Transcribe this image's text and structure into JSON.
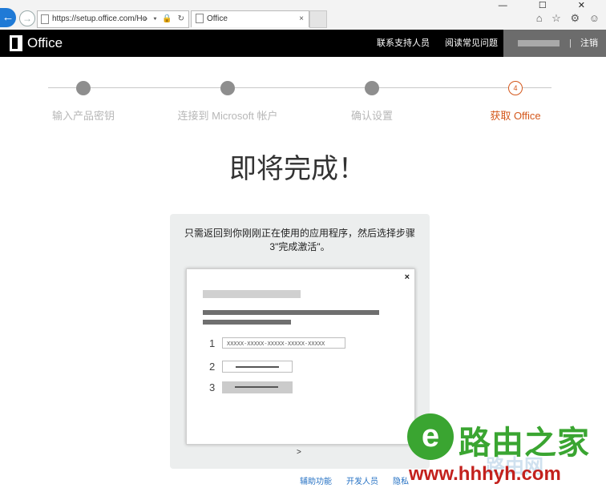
{
  "browser": {
    "url": "https://setup.office.com/Ho",
    "tab_title": "Office",
    "tab_close": "×",
    "back_glyph": "←",
    "forward_glyph": "→",
    "addr_tools": "⌕ ▾ 🔒 ↻",
    "window_controls": "— ☐ ✕",
    "toolbar_icons": "⌂ ☆ ⚙ ☺"
  },
  "header": {
    "brand": "Office",
    "nav_support": "联系支持人员",
    "nav_faq": "阅读常见问题",
    "user_separator": "|",
    "signout": "注销"
  },
  "steps": [
    {
      "label": "输入产品密钥",
      "state": "done"
    },
    {
      "label": "连接到 Microsoft 帐户",
      "state": "done"
    },
    {
      "label": "确认设置",
      "state": "done"
    },
    {
      "label": "获取 Office",
      "state": "current",
      "number": "4"
    }
  ],
  "main": {
    "title": "即将完成！",
    "instruction": "只需返回到你刚刚正在使用的应用程序，然后选择步骤 3\"完成激活\"。"
  },
  "dialog_illustration": {
    "close": "×",
    "n1": "1",
    "n2": "2",
    "n3": "3",
    "key_placeholder": "XXXXX-XXXXX-XXXXX-XXXXX-XXXXX",
    "next_arrow": ">"
  },
  "footer": {
    "accessibility": "辅助功能",
    "developers": "开发人员",
    "privacy": "隐私"
  },
  "watermark": {
    "logo_letter": "e",
    "name": "路由之家",
    "url": "www.hhhyh.com",
    "faint": "路由网"
  },
  "colors": {
    "accent_orange": "#d4571b",
    "header_black": "#000000",
    "link_blue": "#2672c4",
    "watermark_green": "#3aa531",
    "watermark_red": "#c3211d"
  }
}
